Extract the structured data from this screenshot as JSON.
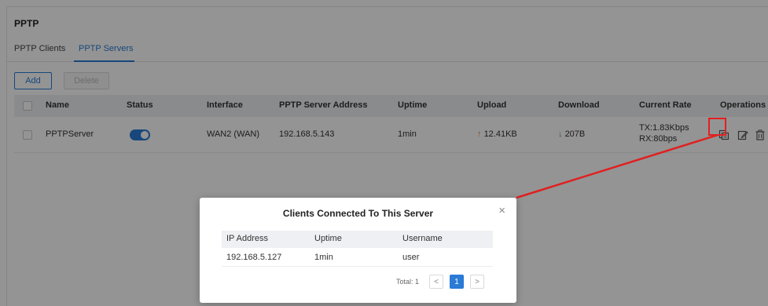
{
  "page": {
    "title": "PPTP"
  },
  "tabs": [
    {
      "label": "PPTP Clients",
      "active": false
    },
    {
      "label": "PPTP Servers",
      "active": true
    }
  ],
  "toolbar": {
    "add_label": "Add",
    "delete_label": "Delete"
  },
  "table": {
    "columns": [
      "Name",
      "Status",
      "Interface",
      "PPTP Server Address",
      "Uptime",
      "Upload",
      "Download",
      "Current Rate",
      "Operations"
    ],
    "rows": [
      {
        "name": "PPTPServer",
        "status_enabled": true,
        "interface": "WAN2 (WAN)",
        "server_address": "192.168.5.143",
        "uptime": "1min",
        "upload": "12.41KB",
        "download": "207B",
        "rate_tx": "TX:1.83Kbps",
        "rate_rx": "RX:80bps",
        "operations": [
          "clients-icon",
          "edit-icon",
          "delete-icon"
        ]
      }
    ]
  },
  "modal": {
    "title": "Clients Connected To This Server",
    "close_glyph": "×",
    "columns": [
      "IP Address",
      "Uptime",
      "Username"
    ],
    "rows": [
      {
        "ip": "192.168.5.127",
        "uptime": "1min",
        "username": "user"
      }
    ],
    "pagination": {
      "total_label": "Total: 1",
      "prev": "<",
      "current_page": "1",
      "next": ">"
    }
  },
  "colors": {
    "accent": "#2a7ad6",
    "highlight": "#e02020",
    "upload": "#e8823a",
    "download": "#3aa55b"
  }
}
